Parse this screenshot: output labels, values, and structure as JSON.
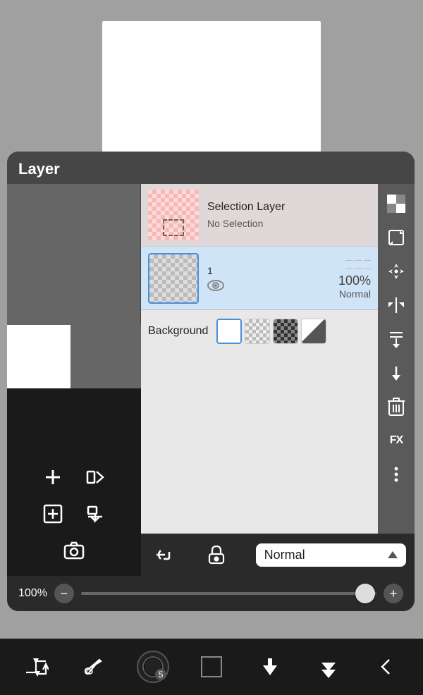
{
  "header": {
    "title": "Layer"
  },
  "layer_panel": {
    "selection_layer": {
      "name": "Selection Layer",
      "sub": "No Selection"
    },
    "layer1": {
      "number": "1",
      "opacity": "100%",
      "mode": "Normal"
    },
    "background": {
      "label": "Background"
    }
  },
  "blend_bar": {
    "mode": "Normal",
    "arrow_label": "▲"
  },
  "zoom_bar": {
    "percent": "100%",
    "minus": "−",
    "plus": "+"
  },
  "bottom_toolbar": {
    "btn1_label": "swap",
    "btn2_label": "brush",
    "btn3_label": "circle",
    "btn4_label": "square",
    "btn5_label": "down",
    "btn6_label": "down-double",
    "btn7_label": "back"
  },
  "right_icons": {
    "checkerboard": "⊞",
    "transform": "⤢",
    "move": "✛",
    "flip": "⇔",
    "merge": "⤓",
    "down": "↓",
    "delete": "🗑",
    "fx": "FX",
    "more": "⋯"
  },
  "left_tools": {
    "add": "+",
    "flip_h": "flip",
    "plus_box": "⊞",
    "merge_down": "⊻",
    "camera": "⊙"
  }
}
